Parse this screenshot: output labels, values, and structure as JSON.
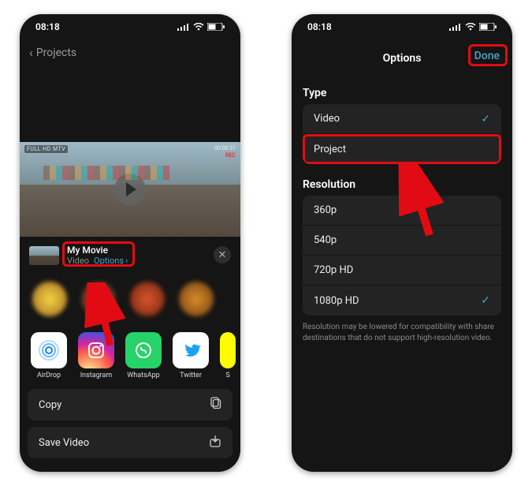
{
  "statusbar": {
    "time": "08:18"
  },
  "left": {
    "back_label": "Projects",
    "video_hud_tl": "FULL HD  MTV",
    "video_hud_tr_line1": "00:00:31",
    "video_hud_tr_rec": "REC",
    "share": {
      "title": "My Movie",
      "subtitle_type": "Video",
      "options_label": "Options"
    },
    "apps": {
      "airdrop": "AirDrop",
      "instagram": "Instagram",
      "whatsapp": "WhatsApp",
      "twitter": "Twitter",
      "snap": "S"
    },
    "actions": {
      "copy": "Copy",
      "save_video": "Save Video"
    }
  },
  "right": {
    "header_title": "Options",
    "done_label": "Done",
    "type_label": "Type",
    "type_options": {
      "video": "Video",
      "project": "Project"
    },
    "resolution_label": "Resolution",
    "resolutions": {
      "r360": "360p",
      "r540": "540p",
      "r720": "720p HD",
      "r1080": "1080p HD"
    },
    "footnote": "Resolution may be lowered for compatibility with share destinations that do not support high-resolution video."
  }
}
